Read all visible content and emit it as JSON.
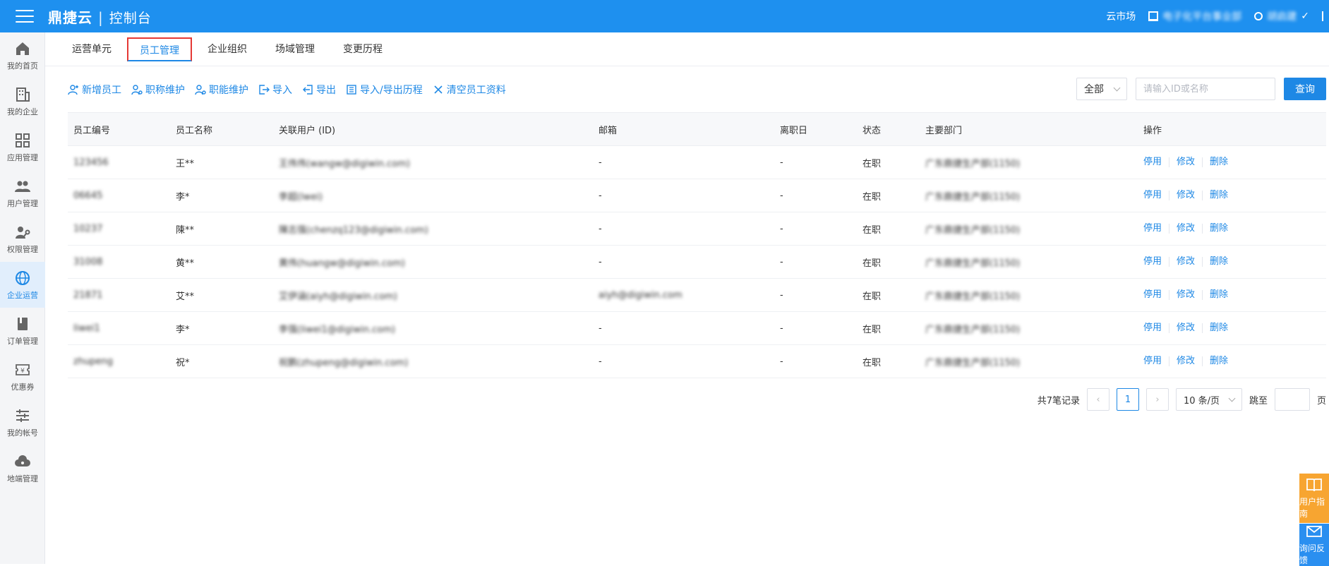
{
  "topbar": {
    "brand": "鼎捷云",
    "separator": "|",
    "subtitle": "控制台",
    "market": "云市场",
    "org": "电子化平台事业部",
    "user": "胡启建"
  },
  "sidebar": {
    "items": [
      {
        "label": "我的首页",
        "icon": "home-icon"
      },
      {
        "label": "我的企业",
        "icon": "building-icon"
      },
      {
        "label": "应用管理",
        "icon": "apps-icon"
      },
      {
        "label": "用户管理",
        "icon": "users-icon"
      },
      {
        "label": "权限管理",
        "icon": "key-user-icon"
      },
      {
        "label": "企业运营",
        "icon": "globe-icon"
      },
      {
        "label": "订单管理",
        "icon": "book-icon"
      },
      {
        "label": "优惠券",
        "icon": "coupon-icon"
      },
      {
        "label": "我的帐号",
        "icon": "sliders-icon"
      },
      {
        "label": "地端管理",
        "icon": "cloud-icon"
      }
    ]
  },
  "tabs": [
    "运营单元",
    "员工管理",
    "企业组织",
    "场域管理",
    "变更历程"
  ],
  "toolbar": {
    "add": "新增员工",
    "title": "职称维护",
    "duty": "职能维护",
    "import": "导入",
    "export": "导出",
    "history": "导入/导出历程",
    "clear": "清空员工资料"
  },
  "search": {
    "scope": "全部",
    "placeholder": "请输入ID或名称",
    "button": "查询"
  },
  "table": {
    "headers": [
      "员工编号",
      "员工名称",
      "关联用户 (ID)",
      "邮箱",
      "离职日",
      "状态",
      "主要部门",
      "操作"
    ],
    "rows": [
      {
        "id": "123456",
        "name": "王**",
        "user": "王伟伟(wangw@digiwin.com)",
        "email": "-",
        "leave": "-",
        "status": "在职",
        "dept": "广东鼎捷生产部(1150)"
      },
      {
        "id": "06645",
        "name": "李*",
        "user": "李超(lwei)",
        "email": "-",
        "leave": "-",
        "status": "在职",
        "dept": "广东鼎捷生产部(1150)"
      },
      {
        "id": "10237",
        "name": "陳**",
        "user": "陳志强(chenzq123@digiwin.com)",
        "email": "-",
        "leave": "-",
        "status": "在职",
        "dept": "广东鼎捷生产部(1150)"
      },
      {
        "id": "31008",
        "name": "黄**",
        "user": "黄伟(huangw@digiwin.com)",
        "email": "-",
        "leave": "-",
        "status": "在职",
        "dept": "广东鼎捷生产部(1150)"
      },
      {
        "id": "21871",
        "name": "艾**",
        "user": "艾伊涵(aiyh@digiwin.com)",
        "email": "aiyh@digiwin.com",
        "leave": "-",
        "status": "在职",
        "dept": "广东鼎捷生产部(1150)"
      },
      {
        "id": "liwei1",
        "name": "李*",
        "user": "李强(liwei1@digiwin.com)",
        "email": "-",
        "leave": "-",
        "status": "在职",
        "dept": "广东鼎捷生产部(1150)"
      },
      {
        "id": "zhupeng",
        "name": "祝*",
        "user": "祝鹏(zhupeng@digiwin.com)",
        "email": "-",
        "leave": "-",
        "status": "在职",
        "dept": "广东鼎捷生产部(1150)"
      }
    ],
    "ops": [
      "停用",
      "修改",
      "删除"
    ]
  },
  "pager": {
    "total": "共7笔记录",
    "current": "1",
    "size": "10 条/页",
    "jump": "跳至",
    "page": "页"
  },
  "floats": {
    "guide": "用户指南",
    "feedback": "询问反馈"
  },
  "colors": {
    "primary": "#1e88e5",
    "topbar": "#1e90ef",
    "tab_highlight": "#e53935",
    "float_orange": "#f7a531"
  }
}
